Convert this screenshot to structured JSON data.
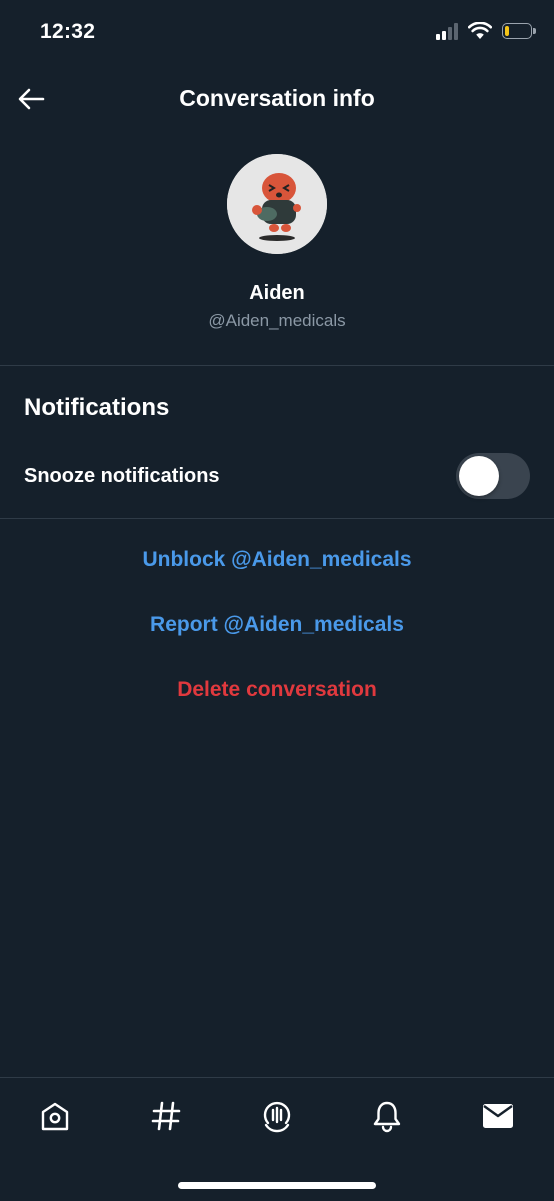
{
  "status_bar": {
    "time": "12:32",
    "signal_bars_active": 2,
    "signal_bars_total": 4,
    "battery_level_fraction": 0.15,
    "battery_color": "#f5c518"
  },
  "header": {
    "title": "Conversation info",
    "back_icon": "arrow-left-icon"
  },
  "profile": {
    "name": "Aiden",
    "handle": "@Aiden_medicals",
    "avatar_icon": "avatar-cartoon-character"
  },
  "notifications": {
    "section_title": "Notifications",
    "snooze_label": "Snooze notifications",
    "snooze_enabled": false
  },
  "actions": {
    "unblock_label": "Unblock @Aiden_medicals",
    "report_label": "Report @Aiden_medicals",
    "delete_label": "Delete conversation",
    "link_color": "#4a99e9",
    "danger_color": "#e0393e"
  },
  "tab_bar": {
    "items": [
      {
        "icon": "home-icon"
      },
      {
        "icon": "explore-hashtag-icon"
      },
      {
        "icon": "spaces-icon"
      },
      {
        "icon": "notifications-bell-icon"
      },
      {
        "icon": "messages-envelope-icon",
        "active": true
      }
    ]
  },
  "theme": {
    "background": "#15202b",
    "divider": "#2f3b47",
    "secondary_text": "#8b98a5"
  }
}
